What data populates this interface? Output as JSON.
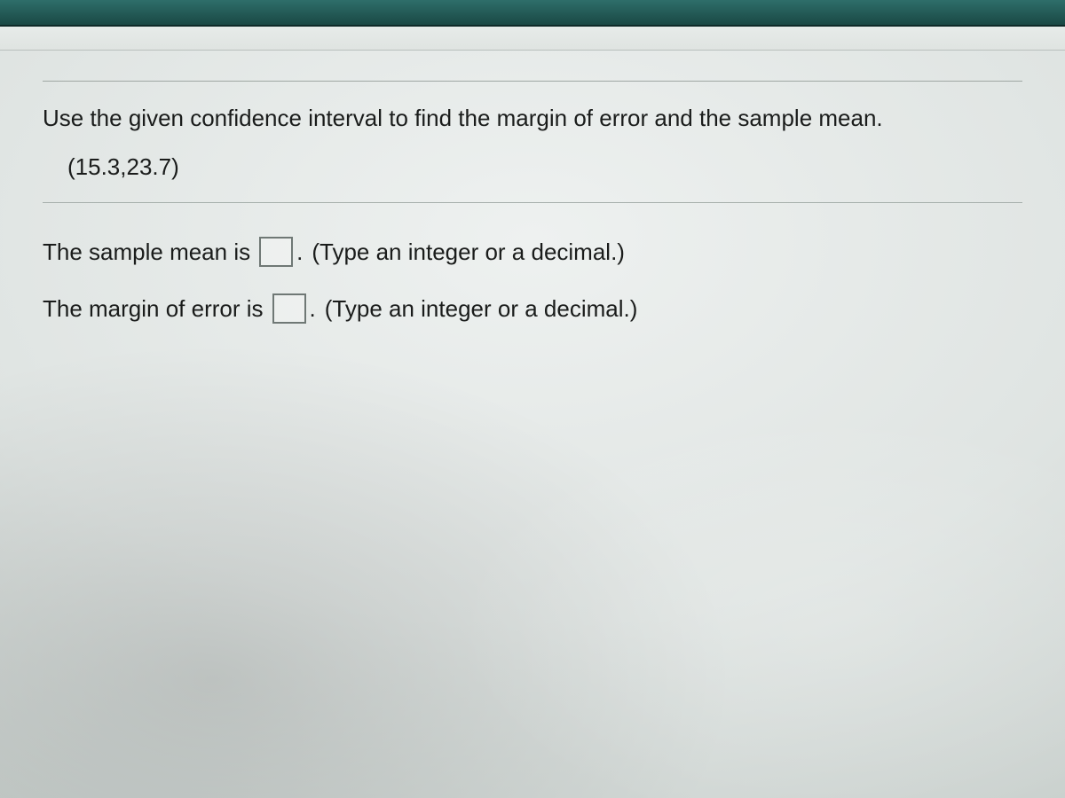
{
  "question": {
    "prompt": "Use the given confidence interval to find the margin of error and the sample mean.",
    "interval": "(15.3,23.7)"
  },
  "answers": {
    "mean": {
      "label_before": "The sample mean is",
      "value": "",
      "hint": "(Type an integer or a decimal.)"
    },
    "moe": {
      "label_before": "The margin of error is",
      "value": "",
      "hint": "(Type an integer or a decimal.)"
    }
  }
}
